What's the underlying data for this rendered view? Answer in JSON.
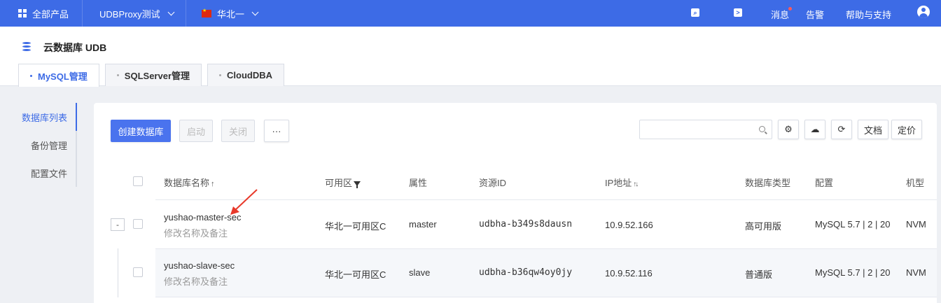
{
  "topbar": {
    "products_label": "全部产品",
    "project_label": "UDBProxy测试",
    "region_label": "华北一",
    "messages_label": "消息",
    "alarm_label": "告警",
    "help_label": "帮助与支持",
    "icons": [
      "grid-icon",
      "search-icon",
      "terminal-icon",
      "user-avatar-icon"
    ]
  },
  "header": {
    "title": "云数据库 UDB",
    "tabs": [
      {
        "label": "MySQL管理",
        "active": true
      },
      {
        "label": "SQLServer管理",
        "active": false
      },
      {
        "label": "CloudDBA",
        "active": false
      }
    ]
  },
  "sidenav": {
    "items": [
      {
        "label": "数据库列表",
        "active": true
      },
      {
        "label": "备份管理",
        "active": false
      },
      {
        "label": "配置文件",
        "active": false
      }
    ]
  },
  "toolbar": {
    "create_label": "创建数据库",
    "start_label": "启动",
    "stop_label": "关闭",
    "more_label": "···",
    "search_placeholder": "",
    "docs_label": "文档",
    "pricing_label": "定价"
  },
  "table": {
    "headers": [
      "数据库名称",
      "可用区",
      "属性",
      "资源ID",
      "IP地址",
      "数据库类型",
      "配置",
      "机型"
    ],
    "rows": [
      {
        "name": "yushao-master-sec",
        "note": "修改名称及备注",
        "zone": "华北一可用区C",
        "role": "master",
        "resource_id": "udbha-b349s8dausn",
        "ip": "10.9.52.166",
        "db_type": "高可用版",
        "config": "MySQL 5.7 | 2 | 20",
        "machine": "NVM"
      },
      {
        "name": "yushao-slave-sec",
        "note": "修改名称及备注",
        "zone": "华北一可用区C",
        "role": "slave",
        "resource_id": "udbha-b36qw4oy0jy",
        "ip": "10.9.52.116",
        "db_type": "普通版",
        "config": "MySQL 5.7 | 2 | 20",
        "machine": "NVM"
      }
    ],
    "expander_label": "-"
  },
  "colors": {
    "topbar": "#3d6be6",
    "primary": "#4a73ee",
    "annotation_arrow": "#e8392a"
  }
}
